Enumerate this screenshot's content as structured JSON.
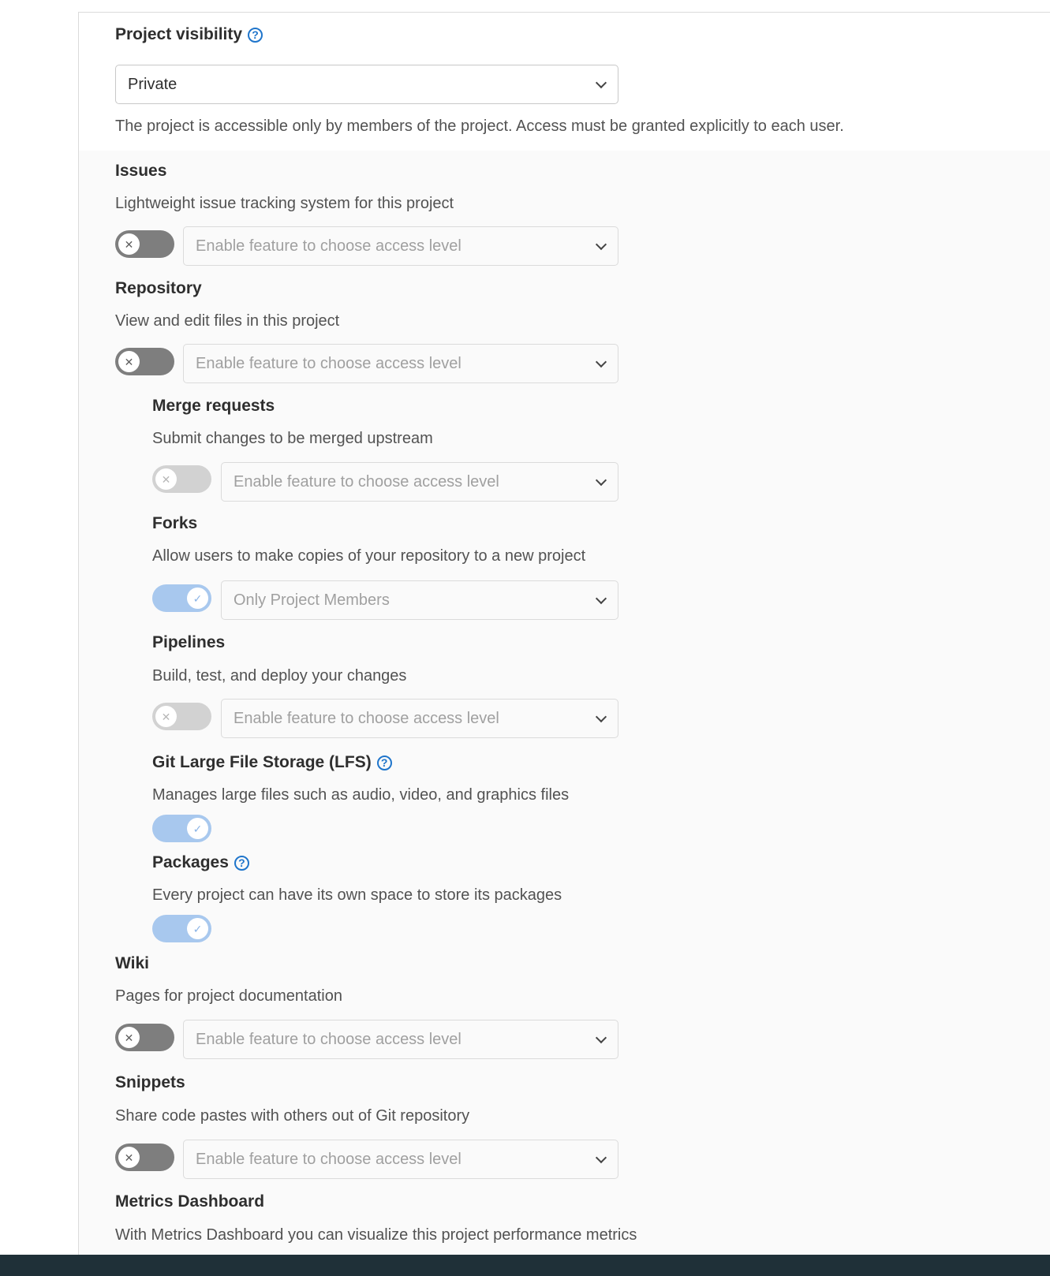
{
  "visibility": {
    "label": "Project visibility",
    "selected": "Private",
    "description": "The project is accessible only by members of the project. Access must be granted explicitly to each user."
  },
  "features": {
    "issues": {
      "title": "Issues",
      "description": "Lightweight issue tracking system for this project",
      "toggle": "off",
      "select": "Enable feature to choose access level"
    },
    "repository": {
      "title": "Repository",
      "description": "View and edit files in this project",
      "toggle": "off",
      "select": "Enable feature to choose access level"
    },
    "merge_requests": {
      "title": "Merge requests",
      "description": "Submit changes to be merged upstream",
      "toggle": "off",
      "select": "Enable feature to choose access level"
    },
    "forks": {
      "title": "Forks",
      "description": "Allow users to make copies of your repository to a new project",
      "toggle": "on",
      "select": "Only Project Members"
    },
    "pipelines": {
      "title": "Pipelines",
      "description": "Build, test, and deploy your changes",
      "toggle": "off",
      "select": "Enable feature to choose access level"
    },
    "lfs": {
      "title": "Git Large File Storage (LFS)",
      "description": "Manages large files such as audio, video, and graphics files",
      "toggle": "on"
    },
    "packages": {
      "title": "Packages",
      "description": "Every project can have its own space to store its packages",
      "toggle": "on"
    },
    "wiki": {
      "title": "Wiki",
      "description": "Pages for project documentation",
      "toggle": "off",
      "select": "Enable feature to choose access level"
    },
    "snippets": {
      "title": "Snippets",
      "description": "Share code pastes with others out of Git repository",
      "toggle": "off",
      "select": "Enable feature to choose access level"
    },
    "metrics": {
      "title": "Metrics Dashboard",
      "description": "With Metrics Dashboard you can visualize this project performance metrics"
    }
  },
  "icons": {
    "help": "question-circle-icon",
    "toggle_off": "x-icon",
    "toggle_on": "check-icon",
    "dropdown": "chevron-down-icon"
  },
  "colors": {
    "accent": "#1f75cb",
    "toggle_off": "#7e7e7e",
    "toggle_on_disabled": "#a8c8ee",
    "bottom_bar": "#1f3038"
  }
}
